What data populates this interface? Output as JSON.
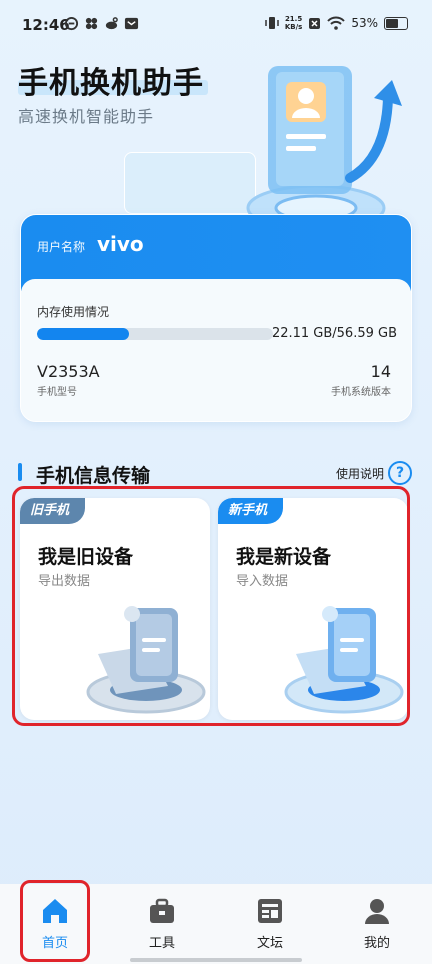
{
  "status_bar": {
    "time": "12:46",
    "speed_value": "21.5",
    "speed_unit": "KB/s",
    "battery": "53%"
  },
  "header": {
    "title": "手机换机助手",
    "subtitle": "高速换机智能助手"
  },
  "device_info": {
    "user_label": "用户名称",
    "user_name": "vivo",
    "memory_label": "内存使用情况",
    "memory_value": "22.11 GB/56.59 GB",
    "memory_used_fraction": 0.391,
    "model_value": "V2353A",
    "model_caption": "手机型号",
    "os_value": "14",
    "os_caption": "手机系统版本"
  },
  "transfer": {
    "section_title": "手机信息传输",
    "help_label": "使用说明",
    "help_icon": "?",
    "old_device": {
      "tag": "旧手机",
      "title": "我是旧设备",
      "subtitle": "导出数据"
    },
    "new_device": {
      "tag": "新手机",
      "title": "我是新设备",
      "subtitle": "导入数据"
    }
  },
  "nav": {
    "items": [
      {
        "label": "首页",
        "icon": "home-icon",
        "active": true
      },
      {
        "label": "工具",
        "icon": "toolbox-icon",
        "active": false
      },
      {
        "label": "文坛",
        "icon": "forum-icon",
        "active": false
      },
      {
        "label": "我的",
        "icon": "profile-icon",
        "active": false
      }
    ]
  },
  "colors": {
    "accent": "#1a8cf0",
    "old_tag": "#5d86ad",
    "highlight": "#e0242b"
  }
}
